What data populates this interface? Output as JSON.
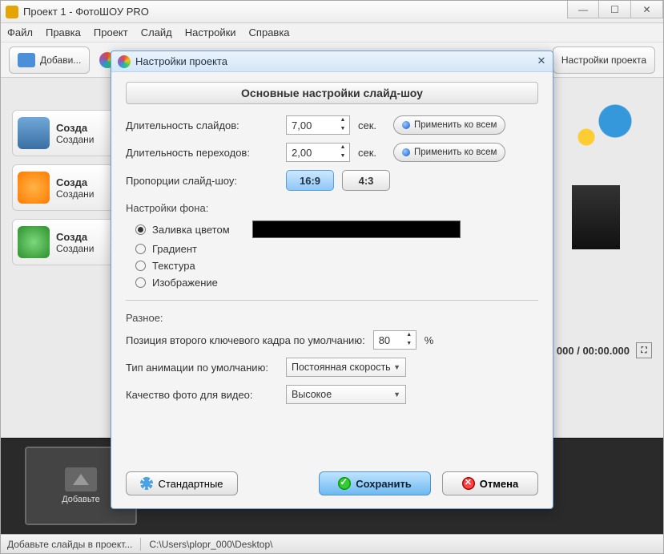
{
  "window": {
    "title": "Проект 1 - ФотоШОУ PRO"
  },
  "menu": {
    "items": [
      "Файл",
      "Правка",
      "Проект",
      "Слайд",
      "Настройки",
      "Справка"
    ]
  },
  "toolbar": {
    "add_label": "Добави...",
    "project_settings_label": "Настройки проекта"
  },
  "left_panel": {
    "cards": [
      {
        "title": "Созда",
        "subtitle": "Создани"
      },
      {
        "title": "Созда",
        "subtitle": "Создани"
      },
      {
        "title": "Созда",
        "subtitle": "Создани"
      }
    ]
  },
  "time": {
    "display": "000 / 00:00.000"
  },
  "timeline": {
    "placeholder": "Добавьте"
  },
  "statusbar": {
    "hint": "Добавьте слайды в проект...",
    "path": "C:\\Users\\plopr_000\\Desktop\\"
  },
  "modal": {
    "title": "Настройки проекта",
    "section_main": "Основные настройки слайд-шоу",
    "slide_duration_label": "Длительность слайдов:",
    "slide_duration_value": "7,00",
    "transition_duration_label": "Длительность переходов:",
    "transition_duration_value": "2,00",
    "seconds_unit": "сек.",
    "apply_all": "Применить ко всем",
    "aspect_label": "Пропорции слайд-шоу:",
    "aspect_169": "16:9",
    "aspect_43": "4:3",
    "bg_group": "Настройки фона:",
    "bg_options": {
      "color": "Заливка цветом",
      "gradient": "Градиент",
      "texture": "Текстура",
      "image": "Изображение"
    },
    "bg_color_value": "#000000",
    "misc_group": "Разное:",
    "keyframe_label": "Позиция второго ключевого кадра по умолчанию:",
    "keyframe_value": "80",
    "percent": "%",
    "anim_type_label": "Тип анимации по умолчанию:",
    "anim_type_value": "Постоянная скорость",
    "photo_quality_label": "Качество фото для видео:",
    "photo_quality_value": "Высокое",
    "defaults_btn": "Стандартные",
    "save_btn": "Сохранить",
    "cancel_btn": "Отмена"
  }
}
